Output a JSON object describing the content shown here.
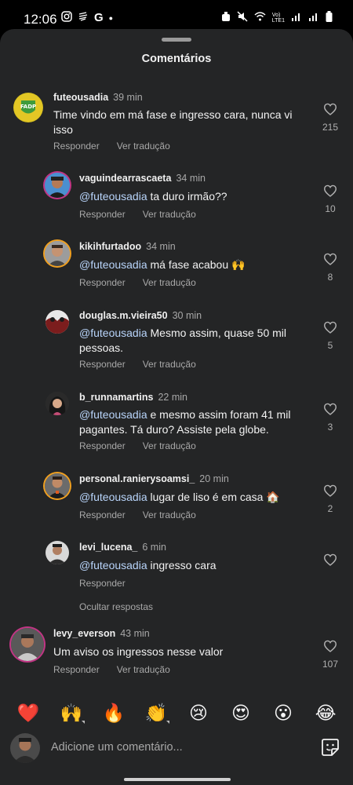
{
  "status": {
    "time": "12:06"
  },
  "sheet": {
    "title": "Comentários"
  },
  "actions": {
    "reply": "Responder",
    "translate": "Ver tradução",
    "hide_replies": "Ocultar respostas"
  },
  "comments": [
    {
      "username": "futeousadia",
      "time": "39 min",
      "text": "Time vindo em má fase e ingresso cara, nunca vi isso",
      "likes": "215",
      "avatar_label": "FADP",
      "avatar_color": "#3f9b3c"
    },
    {
      "username": "vaguindearrascaeta",
      "time": "34 min",
      "mention": "@futeousadia",
      "text": "ta duro irmão??",
      "likes": "10"
    },
    {
      "username": "kikihfurtadoo",
      "time": "34 min",
      "mention": "@futeousadia",
      "text": "má fase acabou 🙌",
      "likes": "8"
    },
    {
      "username": "douglas.m.vieira50",
      "time": "30 min",
      "mention": "@futeousadia",
      "text": "Mesmo assim, quase 50 mil pessoas.",
      "likes": "5"
    },
    {
      "username": "b_runnamartins",
      "time": "22 min",
      "mention": "@futeousadia",
      "text": "e mesmo assim foram 41 mil pagantes. Tá duro? Assiste pela globe.",
      "likes": "3"
    },
    {
      "username": "personal.ranierysoamsi_",
      "time": "20 min",
      "mention": "@futeousadia",
      "text": "lugar de liso é em casa 🏠",
      "likes": "2"
    },
    {
      "username": "levi_lucena_",
      "time": "6 min",
      "mention": "@futeousadia",
      "text": "ingresso cara",
      "likes": ""
    },
    {
      "username": "levy_everson",
      "time": "43 min",
      "text": "Um aviso os ingressos nesse valor",
      "likes": "107"
    }
  ],
  "emojis": [
    "❤️",
    "🙌",
    "🔥",
    "👏",
    "😢",
    "😍",
    "😮",
    "😂"
  ],
  "input": {
    "placeholder": "Adicione um comentário..."
  }
}
